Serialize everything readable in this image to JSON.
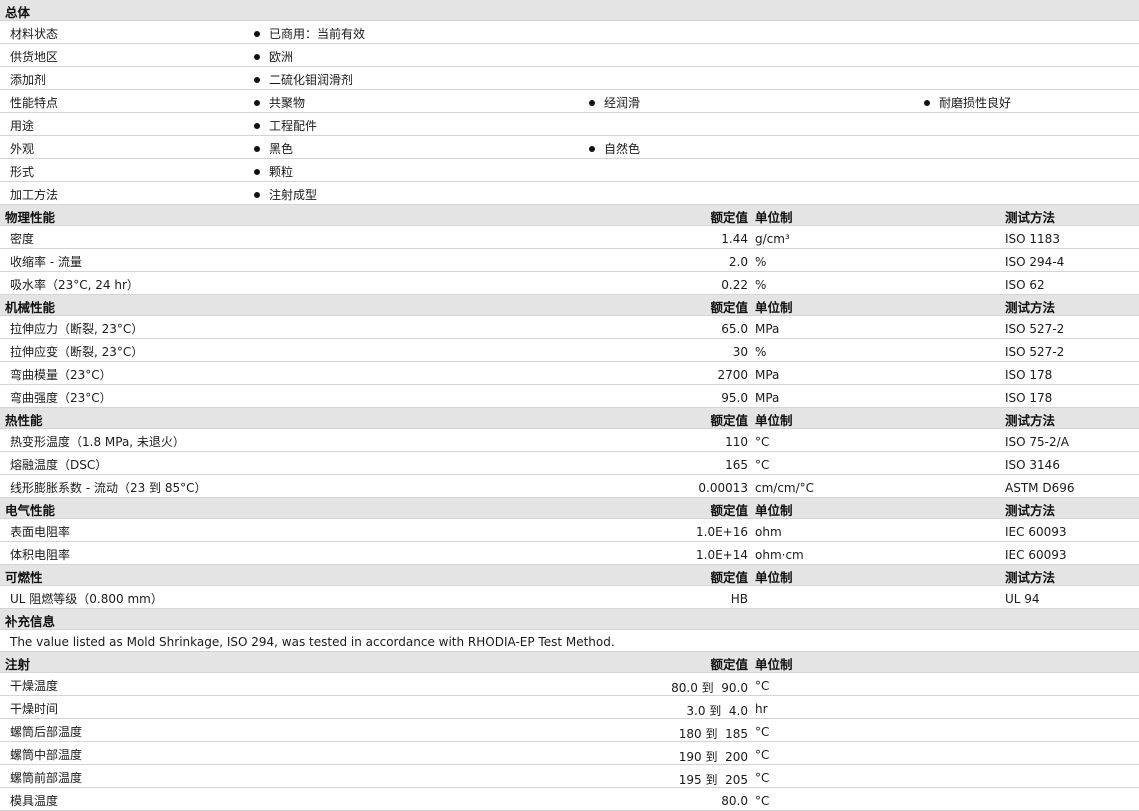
{
  "general": {
    "title": "总体",
    "rows": [
      {
        "label": "材料状态",
        "items": [
          "已商用：当前有效"
        ]
      },
      {
        "label": "供货地区",
        "items": [
          "欧洲"
        ]
      },
      {
        "label": "添加剂",
        "items": [
          "二硫化钼润滑剂"
        ]
      },
      {
        "label": "性能特点",
        "items": [
          "共聚物",
          "经润滑",
          "耐磨损性良好"
        ]
      },
      {
        "label": "用途",
        "items": [
          "工程配件"
        ]
      },
      {
        "label": "外观",
        "items": [
          "黑色",
          "自然色"
        ]
      },
      {
        "label": "形式",
        "items": [
          "颗粒"
        ]
      },
      {
        "label": "加工方法",
        "items": [
          "注射成型"
        ]
      }
    ]
  },
  "col_headers": {
    "value": "额定值",
    "unit": "单位制",
    "test": "测试方法"
  },
  "sections": [
    {
      "title": "物理性能",
      "show_test": true,
      "rows": [
        {
          "label": "密度",
          "value": "1.44",
          "unit": "g/cm³",
          "test": "ISO 1183"
        },
        {
          "label": "收缩率 - 流量",
          "value": "2.0",
          "unit": "%",
          "test": "ISO 294-4"
        },
        {
          "label": "吸水率（23°C, 24 hr）",
          "value": "0.22",
          "unit": "%",
          "test": "ISO 62"
        }
      ]
    },
    {
      "title": "机械性能",
      "show_test": true,
      "rows": [
        {
          "label": "拉伸应力（断裂, 23°C）",
          "value": "65.0",
          "unit": "MPa",
          "test": "ISO 527-2"
        },
        {
          "label": "拉伸应变（断裂, 23°C）",
          "value": "30",
          "unit": "%",
          "test": "ISO 527-2"
        },
        {
          "label": "弯曲模量（23°C）",
          "value": "2700",
          "unit": "MPa",
          "test": "ISO 178"
        },
        {
          "label": "弯曲强度（23°C）",
          "value": "95.0",
          "unit": "MPa",
          "test": "ISO 178"
        }
      ]
    },
    {
      "title": "热性能",
      "show_test": true,
      "rows": [
        {
          "label": "热变形温度（1.8 MPa, 未退火）",
          "value": "110",
          "unit": "°C",
          "test": "ISO 75-2/A"
        },
        {
          "label": "熔融温度（DSC）",
          "value": "165",
          "unit": "°C",
          "test": "ISO 3146"
        },
        {
          "label": "线形膨胀系数 - 流动（23 到 85°C）",
          "value": "0.00013",
          "unit": "cm/cm/°C",
          "test": "ASTM D696"
        }
      ]
    },
    {
      "title": "电气性能",
      "show_test": true,
      "rows": [
        {
          "label": "表面电阻率",
          "value": "1.0E+16",
          "unit": "ohm",
          "test": "IEC 60093"
        },
        {
          "label": "体积电阻率",
          "value": "1.0E+14",
          "unit": "ohm·cm",
          "test": "IEC 60093"
        }
      ]
    },
    {
      "title": "可燃性",
      "show_test": true,
      "rows": [
        {
          "label": "UL 阻燃等级（0.800 mm）",
          "value": "HB",
          "unit": "",
          "test": "UL 94"
        }
      ]
    }
  ],
  "supplement": {
    "title": "补充信息",
    "note": "The value listed as Mold Shrinkage, ISO 294, was tested in accordance with RHODIA-EP Test Method."
  },
  "injection": {
    "title": "注射",
    "rows": [
      {
        "label": "干燥温度",
        "value": "80.0 到  90.0",
        "unit": "°C"
      },
      {
        "label": "干燥时间",
        "value": "3.0 到  4.0",
        "unit": "hr"
      },
      {
        "label": "螺筒后部温度",
        "value": "180 到  185",
        "unit": "°C"
      },
      {
        "label": "螺筒中部温度",
        "value": "190 到  200",
        "unit": "°C"
      },
      {
        "label": "螺筒前部温度",
        "value": "195 到  205",
        "unit": "°C"
      },
      {
        "label": "模具温度",
        "value": "80.0",
        "unit": "°C"
      }
    ]
  }
}
